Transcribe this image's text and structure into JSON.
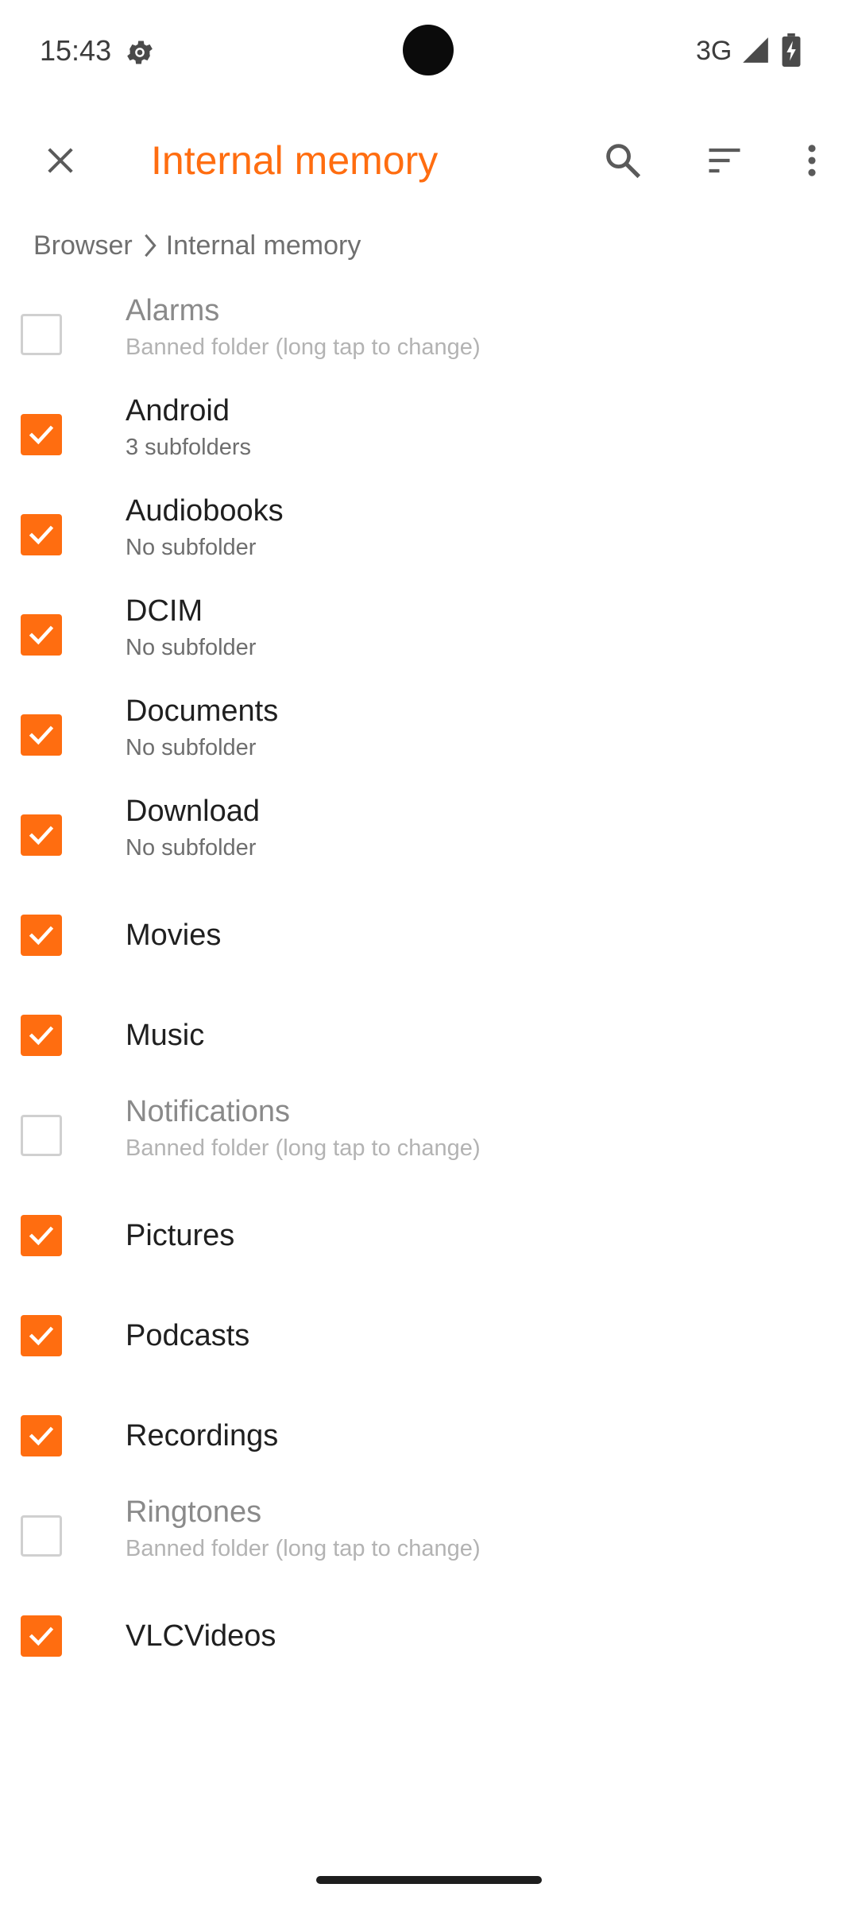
{
  "status_bar": {
    "time": "15:43",
    "network": "3G",
    "icons": [
      "settings-gear-icon",
      "signal-icon",
      "battery-charging-icon"
    ]
  },
  "toolbar": {
    "title": "Internal memory",
    "close_icon": "close-icon",
    "search_icon": "search-icon",
    "sort_icon": "sort-icon",
    "more_icon": "more-vert-icon"
  },
  "breadcrumb": {
    "items": [
      "Browser",
      "Internal memory"
    ],
    "separator_icon": "chevron-right-icon"
  },
  "colors": {
    "accent": "#ff6d10",
    "text_primary": "#1f1f1f",
    "text_secondary": "#6e6e6e",
    "banned_title": "#8a8a8a",
    "banned_subtitle": "#b3b3b3"
  },
  "folders": [
    {
      "name": "Alarms",
      "subtitle": "Banned folder (long tap to change)",
      "checked": false,
      "banned": true
    },
    {
      "name": "Android",
      "subtitle": "3 subfolders",
      "checked": true,
      "banned": false
    },
    {
      "name": "Audiobooks",
      "subtitle": "No subfolder",
      "checked": true,
      "banned": false
    },
    {
      "name": "DCIM",
      "subtitle": "No subfolder",
      "checked": true,
      "banned": false
    },
    {
      "name": "Documents",
      "subtitle": "No subfolder",
      "checked": true,
      "banned": false
    },
    {
      "name": "Download",
      "subtitle": "No subfolder",
      "checked": true,
      "banned": false
    },
    {
      "name": "Movies",
      "subtitle": "",
      "checked": true,
      "banned": false
    },
    {
      "name": "Music",
      "subtitle": "",
      "checked": true,
      "banned": false
    },
    {
      "name": "Notifications",
      "subtitle": "Banned folder (long tap to change)",
      "checked": false,
      "banned": true
    },
    {
      "name": "Pictures",
      "subtitle": "",
      "checked": true,
      "banned": false
    },
    {
      "name": "Podcasts",
      "subtitle": "",
      "checked": true,
      "banned": false
    },
    {
      "name": "Recordings",
      "subtitle": "",
      "checked": true,
      "banned": false
    },
    {
      "name": "Ringtones",
      "subtitle": "Banned folder (long tap to change)",
      "checked": false,
      "banned": true
    },
    {
      "name": "VLCVideos",
      "subtitle": "",
      "checked": true,
      "banned": false
    }
  ]
}
